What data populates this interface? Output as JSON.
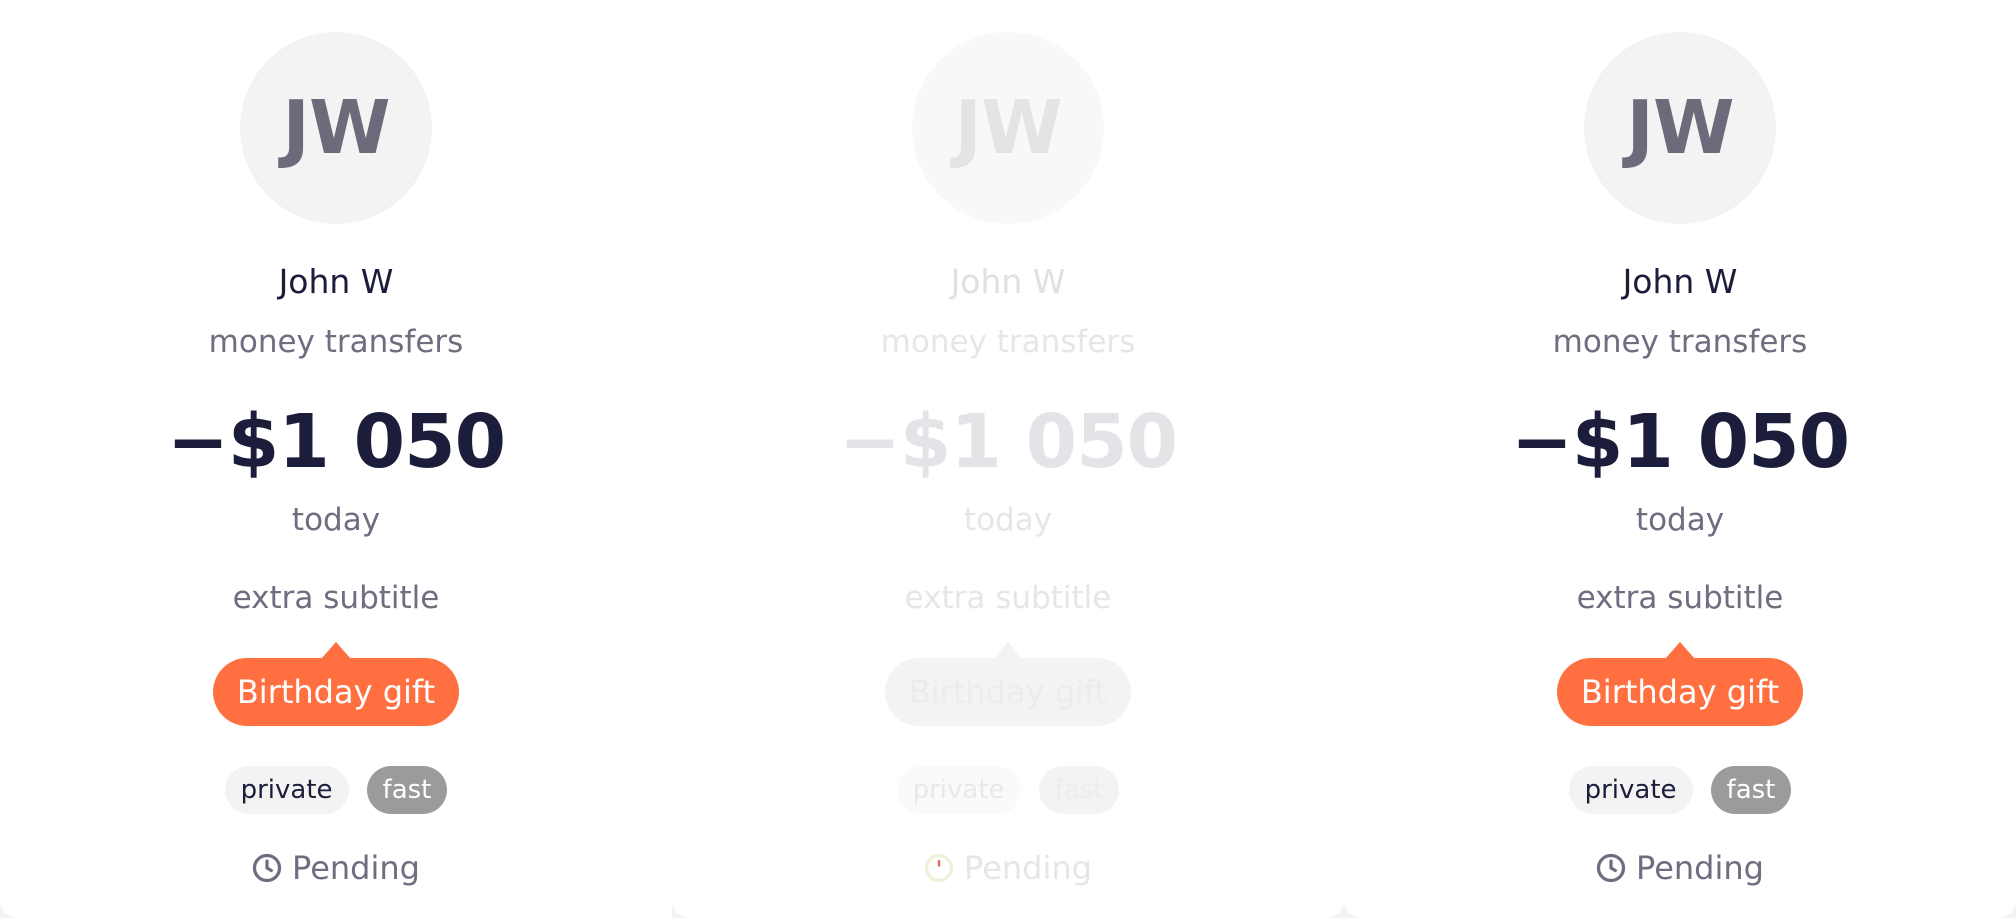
{
  "cards": [
    {
      "state": "normal",
      "avatar_initials": "JW",
      "name": "John W",
      "subtitle": "money transfers",
      "amount": "−$1 050",
      "date": "today",
      "extra_subtitle": "extra subtitle",
      "note": "Birthday gift",
      "tags": [
        "private",
        "fast"
      ],
      "status": "Pending",
      "status_icon": "clock-icon"
    },
    {
      "state": "faded",
      "avatar_initials": "JW",
      "name": "John W",
      "subtitle": "money transfers",
      "amount": "−$1 050",
      "date": "today",
      "extra_subtitle": "extra subtitle",
      "note": "Birthday gift",
      "tags": [
        "private",
        "fast"
      ],
      "status": "Pending",
      "status_icon": "clock-icon"
    },
    {
      "state": "normal",
      "avatar_initials": "JW",
      "name": "John W",
      "subtitle": "money transfers",
      "amount": "−$1 050",
      "date": "today",
      "extra_subtitle": "extra subtitle",
      "note": "Birthday gift",
      "tags": [
        "private",
        "fast"
      ],
      "status": "Pending",
      "status_icon": "clock-icon"
    }
  ],
  "colors": {
    "accent": "#ff6f3f",
    "text_primary": "#1b1d3a",
    "text_secondary": "#6e6e80",
    "tag_dark": "#9b9b9b",
    "avatar_bg": "#f3f3f4"
  }
}
